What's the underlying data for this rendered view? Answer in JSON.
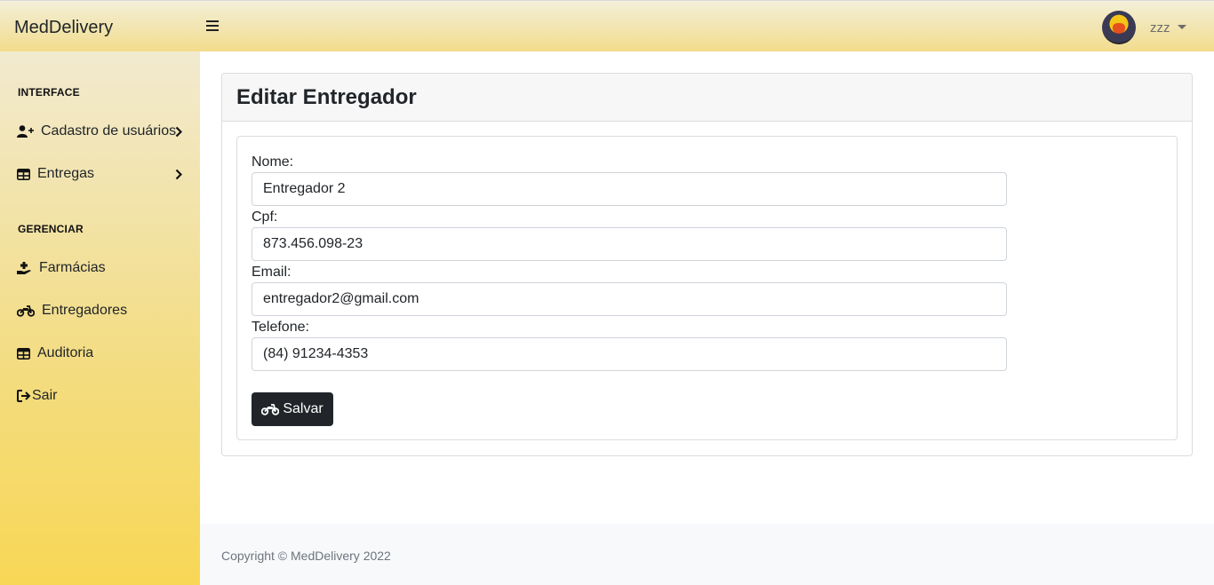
{
  "app": {
    "brand": "MedDelivery",
    "user_name": "zzz"
  },
  "sidebar": {
    "sections": [
      {
        "heading": "INTERFACE"
      },
      {
        "heading": "GERENCIAR"
      }
    ],
    "items": [
      {
        "label": "Cadastro de usuários",
        "icon": "user-plus-icon",
        "has_chevron": true
      },
      {
        "label": "Entregas",
        "icon": "table-icon",
        "has_chevron": true
      },
      {
        "label": "Farmácias",
        "icon": "hand-holding-medical-icon",
        "has_chevron": false
      },
      {
        "label": "Entregadores",
        "icon": "motorcycle-icon",
        "has_chevron": false
      },
      {
        "label": "Auditoria",
        "icon": "table-icon",
        "has_chevron": false
      },
      {
        "label": "Sair",
        "icon": "sign-out-icon",
        "has_chevron": false
      }
    ]
  },
  "main": {
    "title": "Editar Entregador",
    "form": {
      "fields": [
        {
          "label": "Nome:",
          "value": "Entregador 2"
        },
        {
          "label": "Cpf:",
          "value": "873.456.098-23"
        },
        {
          "label": "Email:",
          "value": "entregador2@gmail.com"
        },
        {
          "label": "Telefone:",
          "value": "(84) 91234-4353"
        }
      ],
      "submit_label": "Salvar"
    }
  },
  "footer": {
    "text": "Copyright © MedDelivery 2022"
  },
  "colors": {
    "primary_button": "#212529",
    "sidebar_gradient_end": "#f8d755",
    "topbar_gradient_end": "#f2dc8c"
  }
}
